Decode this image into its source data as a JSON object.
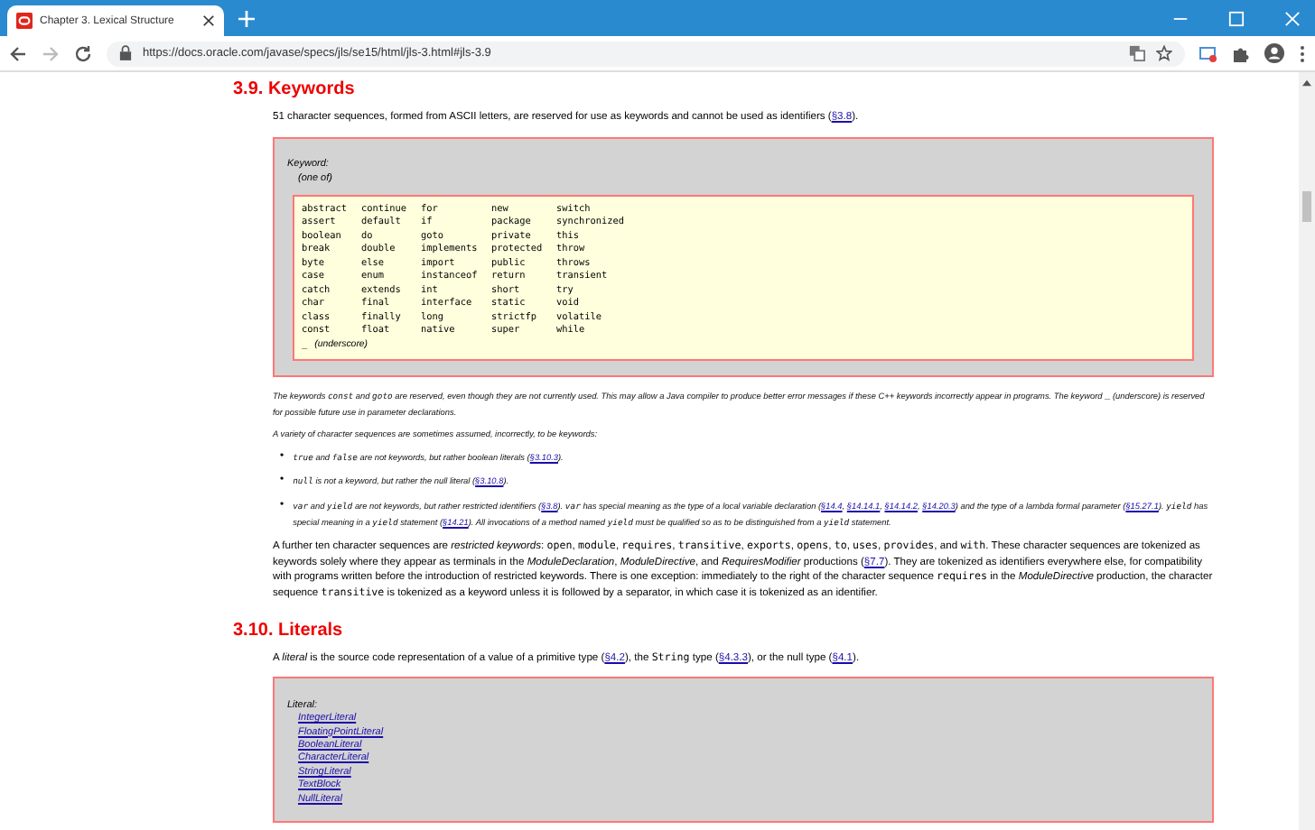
{
  "browser": {
    "tabs": [
      {
        "title": "Chapter 3. Lexical Structure",
        "selected": true
      }
    ],
    "url": "https://docs.oracle.com/javase/specs/jls/se15/html/jls-3.html#jls-3.9",
    "forward_disabled": true
  },
  "page": {
    "section_title": "3.9. Keywords",
    "intro": [
      {
        "kind": "text",
        "t": "51 character sequences, formed from ASCII letters, are reserved for use as keywords and cannot be used as identifiers ("
      },
      {
        "kind": "link",
        "t": "§3.8"
      },
      {
        "kind": "text",
        "t": ")."
      }
    ],
    "grammar": {
      "name": "Keyword:",
      "qualifier": "(one of)",
      "rows": [
        [
          "abstract",
          "continue",
          "for",
          "new",
          "switch"
        ],
        [
          "assert",
          "default",
          "if",
          "package",
          "synchronized"
        ],
        [
          "boolean",
          "do",
          "goto",
          "private",
          "this"
        ],
        [
          "break",
          "double",
          "implements",
          "protected",
          "throw"
        ],
        [
          "byte",
          "else",
          "import",
          "public",
          "throws"
        ],
        [
          "case",
          "enum",
          "instanceof",
          "return",
          "transient"
        ],
        [
          "catch",
          "extends",
          "int",
          "short",
          "try"
        ],
        [
          "char",
          "final",
          "interface",
          "static",
          "void"
        ],
        [
          "class",
          "finally",
          "long",
          "strictfp",
          "volatile"
        ],
        [
          "const",
          "float",
          "native",
          "super",
          "while"
        ]
      ],
      "last": {
        "symbol": "_",
        "note": "(underscore)"
      }
    },
    "note": [
      {
        "kind": "text",
        "t": "The keywords "
      },
      {
        "kind": "code",
        "t": "const"
      },
      {
        "kind": "text",
        "t": " and "
      },
      {
        "kind": "code",
        "t": "goto"
      },
      {
        "kind": "text",
        "t": " are reserved, even though they are not currently used. This may allow a Java compiler to produce better error messages if these C++ keywords incorrectly appear in programs. The keyword "
      },
      {
        "kind": "symbol",
        "t": "_"
      },
      {
        "kind": "text",
        "t": " (underscore) is reserved for possible future use in parameter declarations."
      }
    ],
    "note2": "A variety of character sequences are sometimes assumed, incorrectly, to be keywords:",
    "bullets": [
      {
        "marker": "•",
        "segments": [
          {
            "kind": "code",
            "t": "true"
          },
          {
            "kind": "text",
            "t": " and "
          },
          {
            "kind": "code",
            "t": "false"
          },
          {
            "kind": "text",
            "t": " are not keywords, but rather boolean literals ("
          },
          {
            "kind": "link",
            "t": "§3.10.3"
          },
          {
            "kind": "text",
            "t": ")."
          }
        ]
      },
      {
        "marker": "•",
        "segments": [
          {
            "kind": "code",
            "t": "null"
          },
          {
            "kind": "text",
            "t": " is not a keyword, but rather the null literal ("
          },
          {
            "kind": "link",
            "t": "§3.10.8"
          },
          {
            "kind": "text",
            "t": ")."
          }
        ]
      },
      {
        "marker": "•",
        "segments": [
          {
            "kind": "code",
            "t": "var"
          },
          {
            "kind": "text",
            "t": " and "
          },
          {
            "kind": "code",
            "t": "yield"
          },
          {
            "kind": "text",
            "t": " are not keywords, but rather restricted identifiers ("
          },
          {
            "kind": "link",
            "t": "§3.8"
          },
          {
            "kind": "text",
            "t": "). "
          },
          {
            "kind": "code",
            "t": "var"
          },
          {
            "kind": "text",
            "t": " has special meaning as the type of a local variable declaration ("
          },
          {
            "kind": "link",
            "t": "§14.4"
          },
          {
            "kind": "text",
            "t": ", "
          },
          {
            "kind": "link",
            "t": "§14.14.1"
          },
          {
            "kind": "text",
            "t": ", "
          },
          {
            "kind": "link",
            "t": "§14.14.2"
          },
          {
            "kind": "text",
            "t": ", "
          },
          {
            "kind": "link",
            "t": "§14.20.3"
          },
          {
            "kind": "text",
            "t": ") and the type of a lambda formal parameter ("
          },
          {
            "kind": "link",
            "t": "§15.27.1"
          },
          {
            "kind": "text",
            "t": "). "
          },
          {
            "kind": "code",
            "t": "yield"
          },
          {
            "kind": "text",
            "t": " has special meaning in a "
          },
          {
            "kind": "code",
            "t": "yield"
          },
          {
            "kind": "text",
            "t": " statement ("
          },
          {
            "kind": "link",
            "t": "§14.21"
          },
          {
            "kind": "text",
            "t": "). All invocations of a method named "
          },
          {
            "kind": "code",
            "t": "yield"
          },
          {
            "kind": "text",
            "t": " must be qualified so as to be distinguished from a "
          },
          {
            "kind": "code",
            "t": "yield"
          },
          {
            "kind": "text",
            "t": " statement."
          }
        ]
      }
    ],
    "restricted": [
      {
        "kind": "text",
        "t": "A further ten character sequences are "
      },
      {
        "kind": "em",
        "t": "restricted keywords"
      },
      {
        "kind": "text",
        "t": ": "
      },
      {
        "kind": "code",
        "t": "open"
      },
      {
        "kind": "text",
        "t": ", "
      },
      {
        "kind": "code",
        "t": "module"
      },
      {
        "kind": "text",
        "t": ", "
      },
      {
        "kind": "code",
        "t": "requires"
      },
      {
        "kind": "text",
        "t": ", "
      },
      {
        "kind": "code",
        "t": "transitive"
      },
      {
        "kind": "text",
        "t": ", "
      },
      {
        "kind": "code",
        "t": "exports"
      },
      {
        "kind": "text",
        "t": ", "
      },
      {
        "kind": "code",
        "t": "opens"
      },
      {
        "kind": "text",
        "t": ", "
      },
      {
        "kind": "code",
        "t": "to"
      },
      {
        "kind": "text",
        "t": ", "
      },
      {
        "kind": "code",
        "t": "uses"
      },
      {
        "kind": "text",
        "t": ", "
      },
      {
        "kind": "code",
        "t": "provides"
      },
      {
        "kind": "text",
        "t": ", and "
      },
      {
        "kind": "code",
        "t": "with"
      },
      {
        "kind": "text",
        "t": ". These character sequences are tokenized as keywords solely where they appear as terminals in the "
      },
      {
        "kind": "em",
        "t": "ModuleDeclaration"
      },
      {
        "kind": "text",
        "t": ", "
      },
      {
        "kind": "em",
        "t": "ModuleDirective"
      },
      {
        "kind": "text",
        "t": ", and "
      },
      {
        "kind": "em",
        "t": "RequiresModifier"
      },
      {
        "kind": "text",
        "t": " productions ("
      },
      {
        "kind": "link",
        "t": "§7.7"
      },
      {
        "kind": "text",
        "t": "). They are tokenized as identifiers everywhere else, for compatibility with programs written before the introduction of restricted keywords. There is one exception: immediately to the right of the character sequence "
      },
      {
        "kind": "code",
        "t": "requires"
      },
      {
        "kind": "text",
        "t": " in the "
      },
      {
        "kind": "em",
        "t": "ModuleDirective"
      },
      {
        "kind": "text",
        "t": " production, the character sequence "
      },
      {
        "kind": "code",
        "t": "transitive"
      },
      {
        "kind": "text",
        "t": " is tokenized as a keyword unless it is followed by a separator, in which case it is tokenized as an identifier."
      }
    ],
    "section2_title": "3.10. Literals",
    "literal_intro": [
      {
        "kind": "text",
        "t": "A "
      },
      {
        "kind": "em",
        "t": "literal"
      },
      {
        "kind": "text",
        "t": " is the source code representation of a value of a primitive type ("
      },
      {
        "kind": "link",
        "t": "§4.2"
      },
      {
        "kind": "text",
        "t": "), the "
      },
      {
        "kind": "code",
        "t": "String"
      },
      {
        "kind": "text",
        "t": " type ("
      },
      {
        "kind": "link",
        "t": "§4.3.3"
      },
      {
        "kind": "text",
        "t": "), or the null type ("
      },
      {
        "kind": "link",
        "t": "§4.1"
      },
      {
        "kind": "text",
        "t": ")."
      }
    ],
    "literal_grammar": {
      "name": "Literal:",
      "alternatives": [
        "IntegerLiteral",
        "FloatingPointLiteral",
        "BooleanLiteral",
        "CharacterLiteral",
        "StringLiteral",
        "TextBlock",
        "NullLiteral"
      ]
    }
  }
}
